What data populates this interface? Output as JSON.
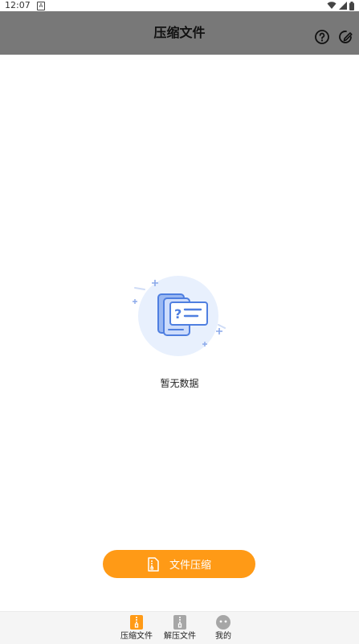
{
  "status_bar": {
    "time": "12:07",
    "a_badge": "A",
    "icons": [
      "wifi-icon",
      "signal-icon",
      "battery-icon"
    ]
  },
  "app_bar": {
    "title": "压缩文件",
    "actions": [
      "help-icon",
      "edit-icon"
    ],
    "background": "#787878"
  },
  "empty_state": {
    "message": "暂无数据",
    "illustration": "empty-document-icon"
  },
  "compress_button": {
    "label": "文件压缩",
    "icon": "file-zip-icon",
    "color": "#ff9a16"
  },
  "bottom_nav": {
    "items": [
      {
        "label": "压缩文件",
        "icon": "zip-file-icon",
        "active": true
      },
      {
        "label": "解压文件",
        "icon": "unzip-file-icon",
        "active": false
      },
      {
        "label": "我的",
        "icon": "profile-face-icon",
        "active": false
      }
    ]
  }
}
